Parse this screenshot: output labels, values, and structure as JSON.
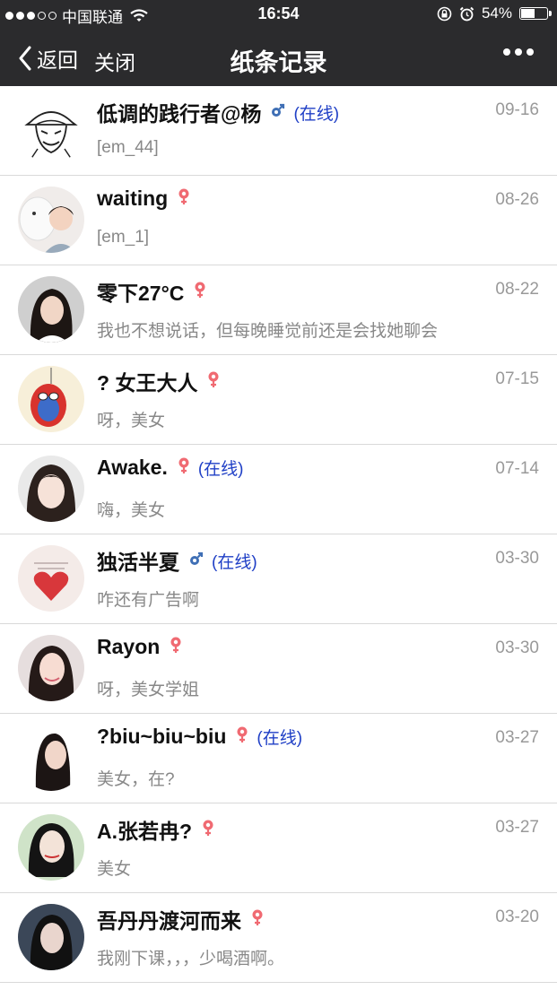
{
  "status_bar": {
    "carrier": "中国联通",
    "time": "16:54",
    "battery_percent": "54%",
    "battery_level": 0.54
  },
  "nav": {
    "back_label": "返回",
    "close_label": "关闭",
    "title": "纸条记录"
  },
  "colors": {
    "bar_bg": "#2b2b2d",
    "online": "#1f3fc6",
    "female": "#f06a72",
    "male": "#3f6fb5"
  },
  "rows": [
    {
      "name": "低调的践行者@杨",
      "gender": "male",
      "online": "(在线)",
      "date": "09-16",
      "message": "[em_44]"
    },
    {
      "name": "waiting",
      "gender": "female",
      "online": "",
      "date": "08-26",
      "message": "[em_1]"
    },
    {
      "name": "零下27°C",
      "gender": "female",
      "online": "",
      "date": "08-22",
      "message": "我也不想说话，但每晚睡觉前还是会找她聊会"
    },
    {
      "name": "? 女王大人",
      "gender": "female",
      "online": "",
      "date": "07-15",
      "message": "呀，美女"
    },
    {
      "name": "Awake.",
      "gender": "female",
      "online": "(在线)",
      "date": "07-14",
      "message": "嗨，美女"
    },
    {
      "name": "独活半夏",
      "gender": "male",
      "online": "(在线)",
      "date": "03-30",
      "message": "咋还有广告啊"
    },
    {
      "name": "Rayon",
      "gender": "female",
      "online": "",
      "date": "03-30",
      "message": "呀，美女学姐"
    },
    {
      "name": "?biu~biu~biu",
      "gender": "female",
      "online": "(在线)",
      "date": "03-27",
      "message": "美女，在?"
    },
    {
      "name": "A.张若冉?",
      "gender": "female",
      "online": "",
      "date": "03-27",
      "message": "美女"
    },
    {
      "name": "吾丹丹渡河而来",
      "gender": "female",
      "online": "",
      "date": "03-20",
      "message": "我刚下课，，，少喝酒啊。"
    }
  ]
}
